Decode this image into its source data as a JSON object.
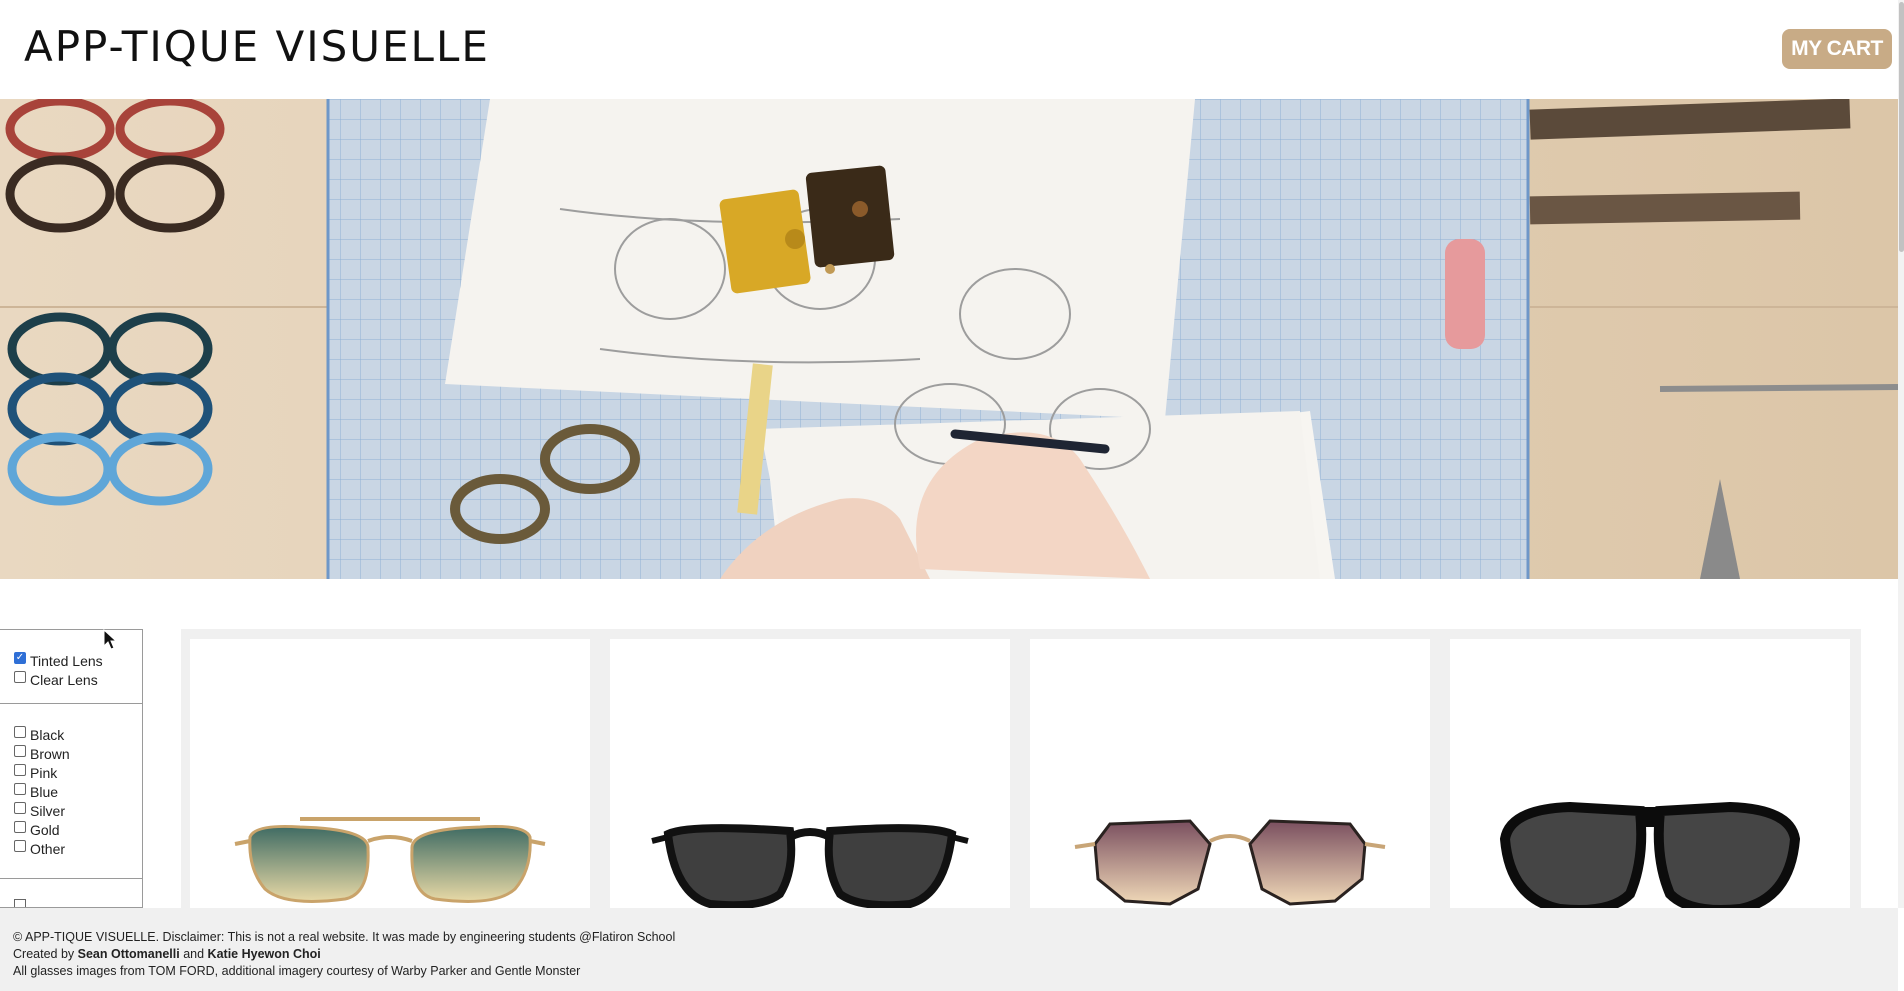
{
  "header": {
    "logo": "APP-TIQUE VISUELLE",
    "cart_label": "MY CART"
  },
  "filters": {
    "lens": [
      {
        "label": "Tinted Lens",
        "checked": true
      },
      {
        "label": "Clear Lens",
        "checked": false
      }
    ],
    "colors": [
      {
        "label": "Black",
        "checked": false
      },
      {
        "label": "Brown",
        "checked": false
      },
      {
        "label": "Pink",
        "checked": false
      },
      {
        "label": "Blue",
        "checked": false
      },
      {
        "label": "Silver",
        "checked": false
      },
      {
        "label": "Gold",
        "checked": false
      },
      {
        "label": "Other",
        "checked": false
      }
    ]
  },
  "products": [
    {
      "lens_top": "#3f6b63",
      "lens_bottom": "#e8d9a6",
      "frame": "#c9a36a",
      "style": "aviator-gold"
    },
    {
      "lens_top": "#3b3b3b",
      "lens_bottom": "#5a5a5a",
      "frame": "#111111",
      "style": "pilot-black"
    },
    {
      "lens_top": "#7a4f5f",
      "lens_bottom": "#f0d9b8",
      "frame": "#c8a577",
      "style": "hexagon-gold"
    },
    {
      "lens_top": "#2b2b2b",
      "lens_bottom": "#555555",
      "frame": "#0c0c0c",
      "style": "shield-black"
    }
  ],
  "footer": {
    "line1": "© APP-TIQUE VISUELLE. Disclaimer: This is not a real website. It was made by engineering students @Flatiron School",
    "created_prefix": "Created by ",
    "author1": "Sean Ottomanelli",
    "and": " and ",
    "author2": "Katie Hyewon Choi",
    "line3": "All glasses images from TOM FORD, additional imagery courtesy of Warby Parker and Gentle Monster"
  },
  "colors": {
    "accent": "#c8ab86",
    "panel_bg": "#f0f0f0"
  }
}
